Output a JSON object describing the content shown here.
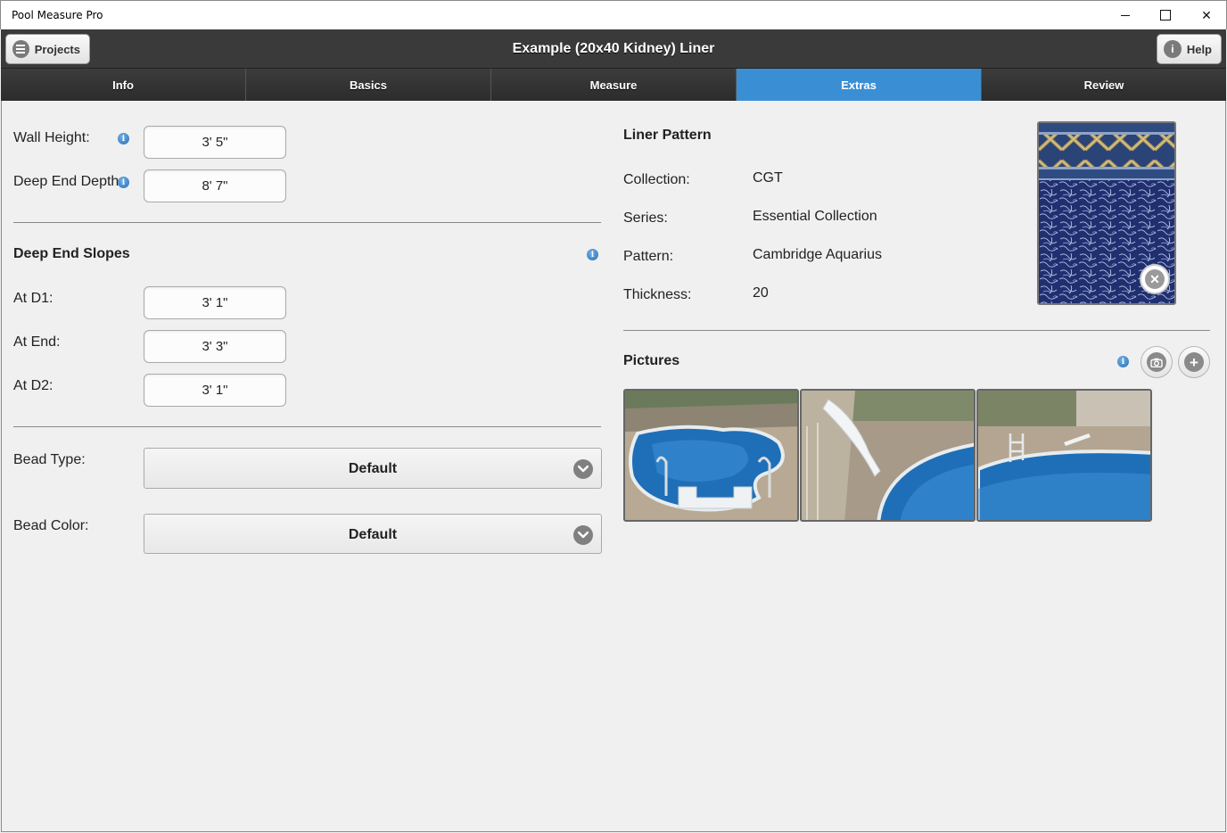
{
  "window": {
    "app_title": "Pool Measure Pro",
    "minimize_label": "",
    "close_label": "✕"
  },
  "header": {
    "title": "Example (20x40 Kidney) Liner",
    "projects_label": "Projects",
    "help_label": "Help",
    "help_icon": "i"
  },
  "tabs": [
    {
      "label": "Info",
      "active": false
    },
    {
      "label": "Basics",
      "active": false
    },
    {
      "label": "Measure",
      "active": false
    },
    {
      "label": "Extras",
      "active": true
    },
    {
      "label": "Review",
      "active": false
    }
  ],
  "dimensions": {
    "wall_height_label": "Wall Height:",
    "wall_height_value": "3' 5\"",
    "deep_end_depth_label": "Deep End Depth",
    "deep_end_depth_value": "8' 7\""
  },
  "slopes": {
    "title": "Deep End Slopes",
    "at_d1_label": "At D1:",
    "at_d1_value": "3' 1\"",
    "at_end_label": "At End:",
    "at_end_value": "3' 3\"",
    "at_d2_label": "At D2:",
    "at_d2_value": "3' 1\""
  },
  "bead": {
    "type_label": "Bead Type:",
    "type_value": "Default",
    "color_label": "Bead Color:",
    "color_value": "Default"
  },
  "liner_pattern": {
    "title": "Liner Pattern",
    "collection_label": "Collection:",
    "collection_value": "CGT",
    "series_label": "Series:",
    "series_value": "Essential Collection",
    "pattern_label": "Pattern:",
    "pattern_value": "Cambridge Aquarius",
    "thickness_label": "Thickness:",
    "thickness_value": "20"
  },
  "pictures": {
    "title": "Pictures",
    "add_symbol": "+",
    "items": [
      "pool-photo-1",
      "pool-photo-2",
      "pool-photo-3"
    ]
  },
  "info_symbol": "i",
  "colors": {
    "accent": "#3a8fd4",
    "header_bg": "#3a3a3a",
    "tab_bg": "#2f2f2f",
    "content_bg": "#f0f0f0"
  }
}
